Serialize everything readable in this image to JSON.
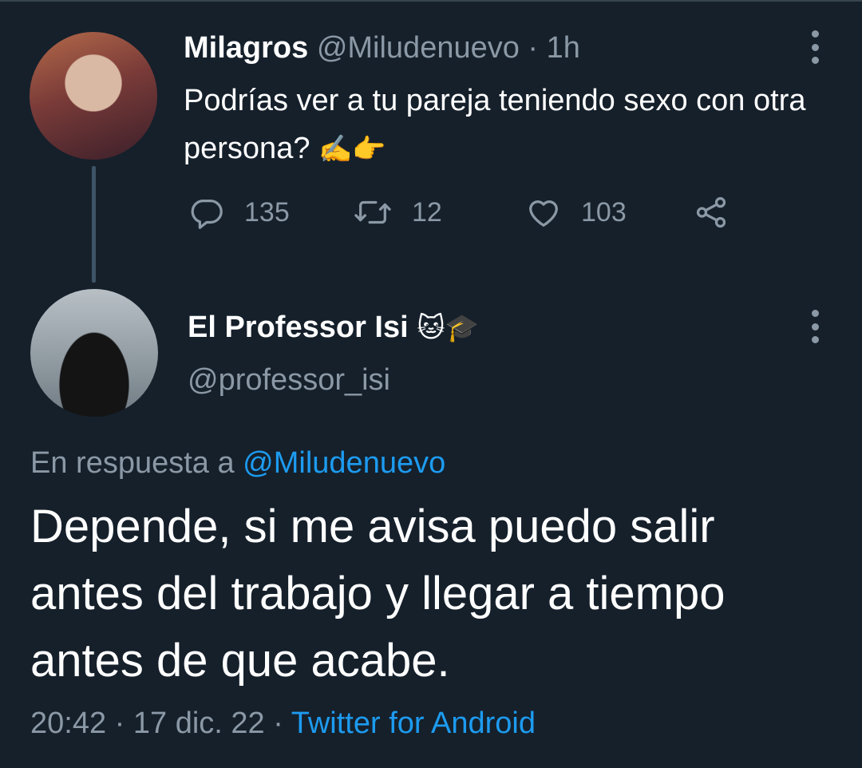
{
  "parent_tweet": {
    "display_name": "Milagros",
    "handle_time": "@Miludenuevo · 1h",
    "text": "Podrías ver a tu pareja teniendo sexo con otra persona?",
    "emojis": "✍️👉",
    "reply_count": "135",
    "retweet_count": "12",
    "like_count": "103"
  },
  "main_tweet": {
    "display_name": "El Professor Isi",
    "name_emojis": "🐱🎓",
    "handle": "@professor_isi",
    "reply_prefix": "En respuesta a ",
    "reply_mention": "@Miludenuevo",
    "text": "Depende, si me avisa puedo salir antes del trabajo y llegar a tiempo antes de que acabe.",
    "timestamp": "20:42 · 17 dic. 22 · ",
    "source": "Twitter for Android"
  },
  "colors": {
    "background": "#15202b",
    "primary_text": "#ffffff",
    "secondary_text": "#8b98a5",
    "accent": "#1d9bf0"
  },
  "icons": [
    "reply-icon",
    "retweet-icon",
    "like-icon",
    "share-icon",
    "more-options-icon"
  ]
}
